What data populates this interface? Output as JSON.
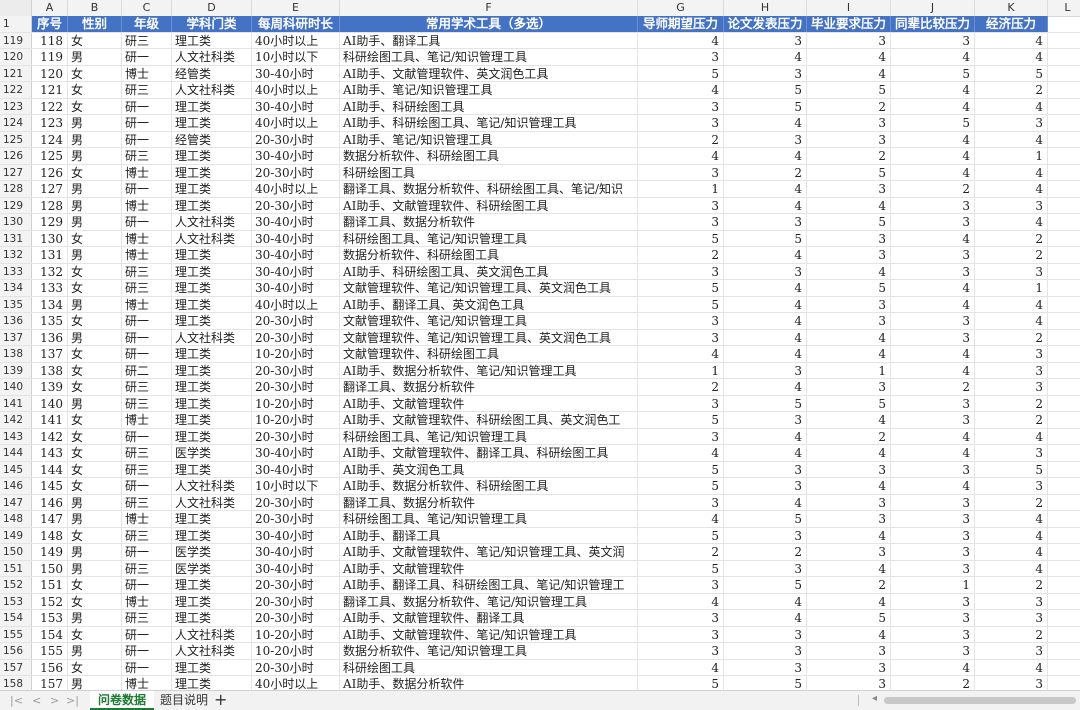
{
  "column_letters": [
    "A",
    "B",
    "C",
    "D",
    "E",
    "F",
    "G",
    "H",
    "I",
    "J",
    "K",
    "L"
  ],
  "header": {
    "row_number": "1",
    "cells": [
      "序号",
      "性别",
      "年级",
      "学科门类",
      "每周科研时长",
      "常用学术工具（多选）",
      "导师期望压力",
      "论文发表压力",
      "毕业要求压力",
      "同辈比较压力",
      "经济压力"
    ]
  },
  "rows": [
    {
      "n": "119",
      "c": [
        "118",
        "女",
        "研三",
        "理工类",
        "40小时以上",
        "AI助手、翻译工具",
        "4",
        "3",
        "3",
        "3",
        "4"
      ]
    },
    {
      "n": "120",
      "c": [
        "119",
        "男",
        "研一",
        "人文社科类",
        "10小时以下",
        "科研绘图工具、笔记/知识管理工具",
        "3",
        "4",
        "4",
        "4",
        "4"
      ]
    },
    {
      "n": "121",
      "c": [
        "120",
        "女",
        "博士",
        "经管类",
        "30-40小时",
        "AI助手、文献管理软件、英文润色工具",
        "5",
        "3",
        "4",
        "5",
        "5"
      ]
    },
    {
      "n": "122",
      "c": [
        "121",
        "女",
        "研三",
        "人文社科类",
        "40小时以上",
        "AI助手、笔记/知识管理工具",
        "4",
        "5",
        "5",
        "4",
        "2"
      ]
    },
    {
      "n": "123",
      "c": [
        "122",
        "女",
        "研一",
        "理工类",
        "30-40小时",
        "AI助手、科研绘图工具",
        "3",
        "5",
        "2",
        "4",
        "4"
      ]
    },
    {
      "n": "124",
      "c": [
        "123",
        "男",
        "研一",
        "理工类",
        "40小时以上",
        "AI助手、科研绘图工具、笔记/知识管理工具",
        "3",
        "4",
        "3",
        "5",
        "3"
      ]
    },
    {
      "n": "125",
      "c": [
        "124",
        "男",
        "研一",
        "经管类",
        "20-30小时",
        "AI助手、笔记/知识管理工具",
        "2",
        "3",
        "3",
        "4",
        "4"
      ]
    },
    {
      "n": "126",
      "c": [
        "125",
        "男",
        "研三",
        "理工类",
        "30-40小时",
        "数据分析软件、科研绘图工具",
        "4",
        "4",
        "2",
        "4",
        "1"
      ]
    },
    {
      "n": "127",
      "c": [
        "126",
        "女",
        "博士",
        "理工类",
        "20-30小时",
        "科研绘图工具",
        "3",
        "2",
        "5",
        "4",
        "4"
      ]
    },
    {
      "n": "128",
      "c": [
        "127",
        "男",
        "研一",
        "理工类",
        "40小时以上",
        "翻译工具、数据分析软件、科研绘图工具、笔记/知识",
        "1",
        "4",
        "3",
        "2",
        "4"
      ]
    },
    {
      "n": "129",
      "c": [
        "128",
        "男",
        "博士",
        "理工类",
        "20-30小时",
        "AI助手、文献管理软件、科研绘图工具",
        "3",
        "4",
        "4",
        "3",
        "3"
      ]
    },
    {
      "n": "130",
      "c": [
        "129",
        "男",
        "研一",
        "人文社科类",
        "30-40小时",
        "翻译工具、数据分析软件",
        "3",
        "3",
        "5",
        "3",
        "4"
      ]
    },
    {
      "n": "131",
      "c": [
        "130",
        "女",
        "博士",
        "人文社科类",
        "30-40小时",
        "科研绘图工具、笔记/知识管理工具",
        "5",
        "5",
        "3",
        "4",
        "2"
      ]
    },
    {
      "n": "132",
      "c": [
        "131",
        "男",
        "博士",
        "理工类",
        "30-40小时",
        "数据分析软件、科研绘图工具",
        "2",
        "4",
        "3",
        "3",
        "2"
      ]
    },
    {
      "n": "133",
      "c": [
        "132",
        "女",
        "研三",
        "理工类",
        "30-40小时",
        "AI助手、科研绘图工具、英文润色工具",
        "3",
        "3",
        "4",
        "3",
        "3"
      ]
    },
    {
      "n": "134",
      "c": [
        "133",
        "女",
        "研三",
        "理工类",
        "30-40小时",
        "文献管理软件、笔记/知识管理工具、英文润色工具",
        "5",
        "4",
        "5",
        "4",
        "1"
      ]
    },
    {
      "n": "135",
      "c": [
        "134",
        "男",
        "博士",
        "理工类",
        "40小时以上",
        "AI助手、翻译工具、英文润色工具",
        "5",
        "4",
        "3",
        "4",
        "4"
      ]
    },
    {
      "n": "136",
      "c": [
        "135",
        "女",
        "研一",
        "理工类",
        "20-30小时",
        "文献管理软件、笔记/知识管理工具",
        "3",
        "4",
        "3",
        "3",
        "4"
      ]
    },
    {
      "n": "137",
      "c": [
        "136",
        "男",
        "研一",
        "人文社科类",
        "20-30小时",
        "文献管理软件、笔记/知识管理工具、英文润色工具",
        "3",
        "4",
        "4",
        "3",
        "2"
      ]
    },
    {
      "n": "138",
      "c": [
        "137",
        "女",
        "研一",
        "理工类",
        "10-20小时",
        "文献管理软件、科研绘图工具",
        "4",
        "4",
        "4",
        "4",
        "3"
      ]
    },
    {
      "n": "139",
      "c": [
        "138",
        "女",
        "研二",
        "理工类",
        "20-30小时",
        "AI助手、数据分析软件、笔记/知识管理工具",
        "1",
        "3",
        "1",
        "4",
        "3"
      ]
    },
    {
      "n": "140",
      "c": [
        "139",
        "女",
        "研三",
        "理工类",
        "20-30小时",
        "翻译工具、数据分析软件",
        "2",
        "4",
        "3",
        "2",
        "3"
      ]
    },
    {
      "n": "141",
      "c": [
        "140",
        "男",
        "研三",
        "理工类",
        "10-20小时",
        "AI助手、文献管理软件",
        "3",
        "5",
        "5",
        "3",
        "2"
      ]
    },
    {
      "n": "142",
      "c": [
        "141",
        "女",
        "博士",
        "理工类",
        "10-20小时",
        "AI助手、文献管理软件、科研绘图工具、英文润色工",
        "5",
        "3",
        "4",
        "3",
        "2"
      ]
    },
    {
      "n": "143",
      "c": [
        "142",
        "女",
        "研一",
        "理工类",
        "20-30小时",
        "科研绘图工具、笔记/知识管理工具",
        "3",
        "4",
        "2",
        "4",
        "4"
      ]
    },
    {
      "n": "144",
      "c": [
        "143",
        "女",
        "研三",
        "医学类",
        "30-40小时",
        "AI助手、文献管理软件、翻译工具、科研绘图工具",
        "4",
        "4",
        "4",
        "4",
        "3"
      ]
    },
    {
      "n": "145",
      "c": [
        "144",
        "女",
        "研三",
        "理工类",
        "30-40小时",
        "AI助手、英文润色工具",
        "5",
        "3",
        "3",
        "3",
        "5"
      ]
    },
    {
      "n": "146",
      "c": [
        "145",
        "女",
        "研一",
        "人文社科类",
        "10小时以下",
        "AI助手、数据分析软件、科研绘图工具",
        "5",
        "3",
        "4",
        "4",
        "3"
      ]
    },
    {
      "n": "147",
      "c": [
        "146",
        "男",
        "研三",
        "人文社科类",
        "20-30小时",
        "翻译工具、数据分析软件",
        "3",
        "4",
        "3",
        "3",
        "2"
      ]
    },
    {
      "n": "148",
      "c": [
        "147",
        "男",
        "博士",
        "理工类",
        "20-30小时",
        "科研绘图工具、笔记/知识管理工具",
        "4",
        "5",
        "3",
        "3",
        "4"
      ]
    },
    {
      "n": "149",
      "c": [
        "148",
        "女",
        "研三",
        "理工类",
        "30-40小时",
        "AI助手、翻译工具",
        "5",
        "3",
        "4",
        "3",
        "4"
      ]
    },
    {
      "n": "150",
      "c": [
        "149",
        "男",
        "研一",
        "医学类",
        "30-40小时",
        "AI助手、文献管理软件、笔记/知识管理工具、英文润",
        "2",
        "2",
        "3",
        "3",
        "4"
      ]
    },
    {
      "n": "151",
      "c": [
        "150",
        "男",
        "研三",
        "医学类",
        "30-40小时",
        "AI助手、文献管理软件",
        "5",
        "3",
        "4",
        "3",
        "4"
      ]
    },
    {
      "n": "152",
      "c": [
        "151",
        "女",
        "研一",
        "理工类",
        "20-30小时",
        "AI助手、翻译工具、科研绘图工具、笔记/知识管理工",
        "3",
        "5",
        "2",
        "1",
        "2"
      ]
    },
    {
      "n": "153",
      "c": [
        "152",
        "女",
        "博士",
        "理工类",
        "20-30小时",
        "翻译工具、数据分析软件、笔记/知识管理工具",
        "4",
        "4",
        "4",
        "3",
        "3"
      ]
    },
    {
      "n": "154",
      "c": [
        "153",
        "男",
        "研三",
        "理工类",
        "20-30小时",
        "AI助手、文献管理软件、翻译工具",
        "3",
        "4",
        "5",
        "3",
        "3"
      ]
    },
    {
      "n": "155",
      "c": [
        "154",
        "女",
        "研一",
        "人文社科类",
        "10-20小时",
        "AI助手、文献管理软件、笔记/知识管理工具",
        "3",
        "3",
        "4",
        "3",
        "2"
      ]
    },
    {
      "n": "156",
      "c": [
        "155",
        "男",
        "研一",
        "人文社科类",
        "10-20小时",
        "数据分析软件、笔记/知识管理工具",
        "3",
        "3",
        "3",
        "3",
        "3"
      ]
    },
    {
      "n": "157",
      "c": [
        "156",
        "女",
        "研一",
        "理工类",
        "20-30小时",
        "科研绘图工具",
        "4",
        "3",
        "3",
        "4",
        "4"
      ]
    },
    {
      "n": "158",
      "c": [
        "157",
        "男",
        "博士",
        "理工类",
        "40小时以上",
        "AI助手、数据分析软件",
        "5",
        "5",
        "3",
        "2",
        "3"
      ]
    }
  ],
  "tabs": [
    {
      "label": "问卷数据",
      "active": true
    },
    {
      "label": "题目说明",
      "active": false
    }
  ],
  "nav": {
    "first": "|<",
    "prev": "<",
    "next": ">",
    "last": ">|",
    "add": "+"
  },
  "colors": {
    "header_bg": "#4472c4",
    "header_text": "#ffffff",
    "active_tab": "#1e7b34"
  }
}
